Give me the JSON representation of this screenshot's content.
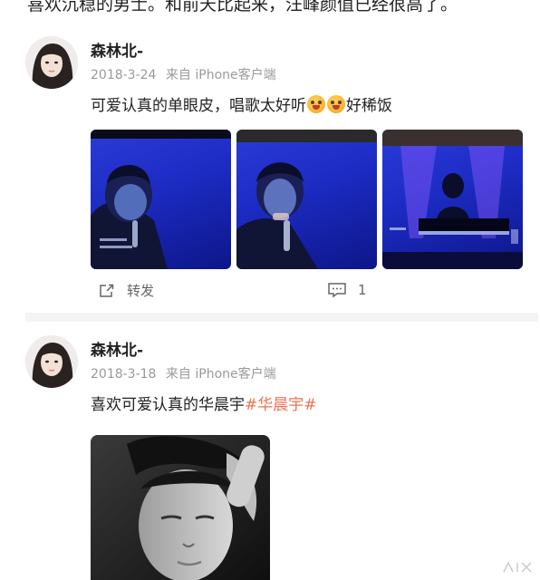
{
  "top_text": "喜欢沉稳的男士。和前天比起来，汪峰颜值已经很高了。",
  "posts": [
    {
      "username": "森林北-",
      "date": "2018-3-24",
      "source": "来自 iPhone客户端",
      "text_before": "可爱认真的单眼皮，唱歌太好听",
      "text_after": "好稀饭",
      "emoji_count": 2,
      "photo_count": 3,
      "repost_label": "转发",
      "comment_count": "1",
      "icons": [
        "repost-icon",
        "comment-icon"
      ]
    },
    {
      "username": "森林北-",
      "date": "2018-3-18",
      "source": "来自 iPhone客户端",
      "text": "喜欢可爱认真的华晨宇",
      "hashtag": "#华晨宇#",
      "photo_count": 1
    }
  ],
  "colors": {
    "hashtag": "#eb7350",
    "meta": "#9a9a9a",
    "photo_blue": "#1c2bc2"
  }
}
